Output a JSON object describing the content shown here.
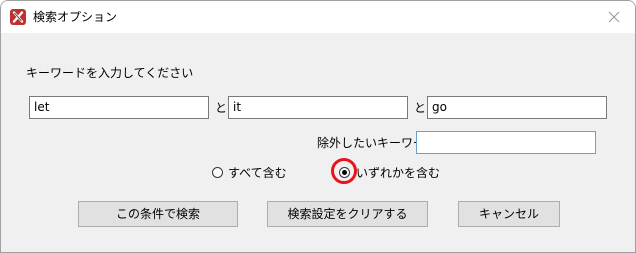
{
  "window": {
    "title": "検索オプション",
    "app_icon": "app-x-icon",
    "close_icon": "close-icon"
  },
  "form": {
    "instruction": "キーワードを入力してください",
    "keyword1": "let",
    "keyword2": "it",
    "keyword3": "go",
    "conjunction1": "と",
    "conjunction2": "と",
    "exclude_label": "除外したいキーワード",
    "exclude_value": ""
  },
  "options": {
    "all_label": "すべて含む",
    "any_label": "いずれかを含む",
    "selected": "any"
  },
  "buttons": {
    "search": "この条件で検索",
    "clear": "検索設定をクリアする",
    "cancel": "キャンセル"
  },
  "colors": {
    "highlight": "#e8141c",
    "app_icon_bg": "#c0302f"
  }
}
